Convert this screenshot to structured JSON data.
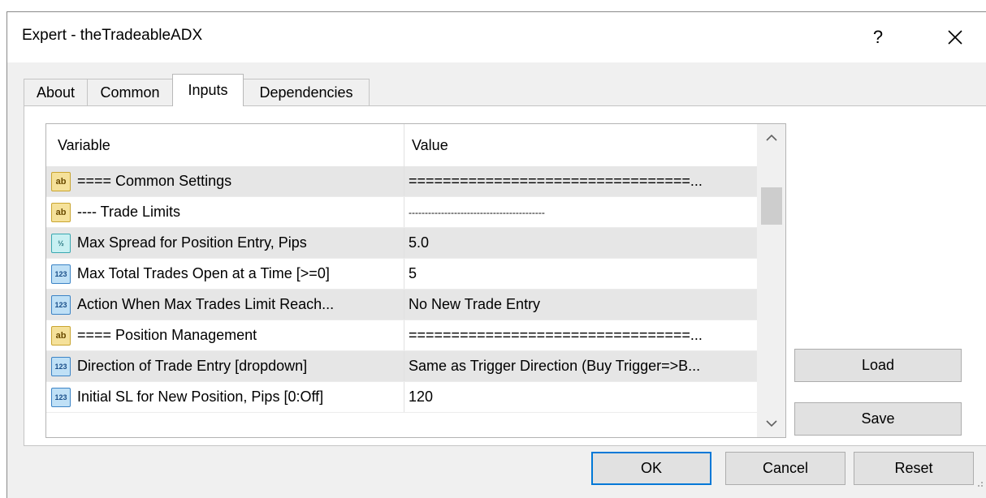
{
  "window": {
    "title": "Expert - theTradeableADX",
    "help_label": "?"
  },
  "tabs": [
    {
      "label": "About"
    },
    {
      "label": "Common"
    },
    {
      "label": "Inputs"
    },
    {
      "label": "Dependencies"
    }
  ],
  "active_tab": "Inputs",
  "grid": {
    "columns": {
      "variable": "Variable",
      "value": "Value"
    },
    "rows": [
      {
        "icon": "ab",
        "variable": "==== Common Settings",
        "value": "=================================..."
      },
      {
        "icon": "ab",
        "variable": "---- Trade Limits",
        "value": "------------------------------------------"
      },
      {
        "icon": "frac",
        "variable": "Max Spread for Position Entry, Pips",
        "value": "5.0"
      },
      {
        "icon": "123",
        "variable": "Max Total Trades Open at a Time [>=0]",
        "value": "5"
      },
      {
        "icon": "123",
        "variable": "Action When Max Trades Limit Reach...",
        "value": "No New Trade Entry"
      },
      {
        "icon": "ab",
        "variable": "==== Position Management",
        "value": "=================================..."
      },
      {
        "icon": "123",
        "variable": "Direction of Trade Entry [dropdown]",
        "value": "Same as Trigger Direction (Buy Trigger=>B..."
      },
      {
        "icon": "123",
        "variable": "Initial SL for New Position, Pips [0:Off]",
        "value": "120"
      }
    ]
  },
  "side_buttons": {
    "load": "Load",
    "save": "Save"
  },
  "footer_buttons": {
    "ok": "OK",
    "cancel": "Cancel",
    "reset": "Reset"
  },
  "icon_text": {
    "ab": "ab",
    "n123": "123",
    "frac": "½"
  },
  "colors": {
    "accent": "#0078d7",
    "shaded_row": "#e6e6e6"
  }
}
